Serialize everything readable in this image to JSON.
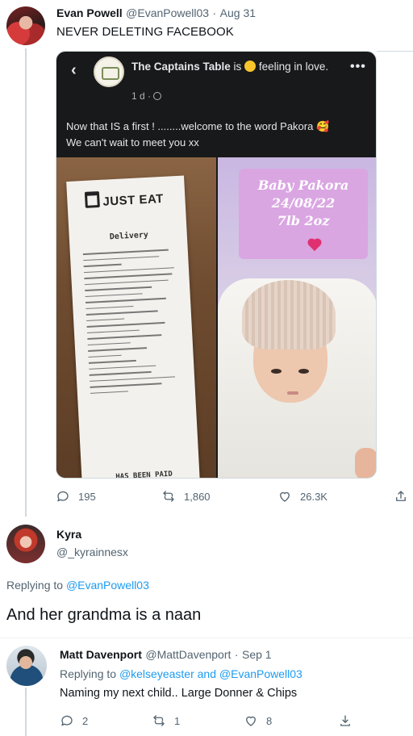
{
  "tweet1": {
    "name": "Evan Powell",
    "handle": "@EvanPowell03",
    "date": "Aug 31",
    "separator": "·",
    "text": "NEVER DELETING FACEBOOK",
    "stats": {
      "replies": "195",
      "retweets": "1,860",
      "likes": "26.3K"
    }
  },
  "fb_post": {
    "page_name": "The Captains Table",
    "status_prefix": "is",
    "status": "feeling in love.",
    "meta": "1 d ·",
    "text_line1": "Now that IS a first ! ........welcome to the word Pakora 🥰",
    "text_line2": "We can't wait to meet you xx"
  },
  "receipt": {
    "logo": "JUST EAT",
    "delivery": "Delivery",
    "paid": "HAS BEEN PAID"
  },
  "baby_sign": {
    "line1": "Baby Pakora",
    "line2": "24/08/22",
    "line3": "7lb 2oz"
  },
  "tweet2": {
    "name": "Kyra",
    "handle": "@_kyrainnesx",
    "replying_label": "Replying to",
    "replying_to": "@EvanPowell03",
    "text": "And her grandma is a naan"
  },
  "tweet3": {
    "name": "Matt Davenport",
    "handle": "@MattDavenport",
    "date": "Sep 1",
    "separator": "·",
    "replying_label": "Replying to",
    "replying_to_1": "@kelseyeaster",
    "replying_and": "and",
    "replying_to_2": "@EvanPowell03",
    "text": "Naming my next child.. Large Donner & Chips",
    "stats": {
      "replies": "2",
      "retweets": "1",
      "likes": "8"
    }
  },
  "colors": {
    "link": "#1d9bf0",
    "secondary_text": "#536471",
    "fb_bg": "#18191a"
  }
}
